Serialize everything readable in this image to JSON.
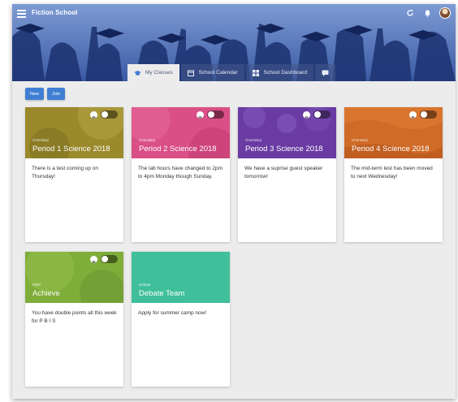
{
  "app": {
    "title": "Fiction School"
  },
  "colors": {
    "accent": "#3f7fd3",
    "banner": "#4a6cb6",
    "page_bg": "#ececec"
  },
  "top_icons": [
    "refresh-icon",
    "bell-icon",
    "avatar"
  ],
  "tabs": [
    {
      "label": "My Classes",
      "icon": "graduation-cap-icon",
      "active": true
    },
    {
      "label": "School Calendar",
      "icon": "calendar-icon",
      "active": false
    },
    {
      "label": "School Dashboard",
      "icon": "dashboard-icon",
      "active": false
    },
    {
      "label": "",
      "icon": "message-icon",
      "active": false
    }
  ],
  "actions": {
    "new_label": "New",
    "join_label": "Join"
  },
  "cards": [
    {
      "subject": "Chemistry",
      "title": "Period 1 Science 2018",
      "body": "There is a test coming up on Thursday!",
      "color": "#9b8a2c"
    },
    {
      "subject": "Chemistry",
      "title": "Period 2 Science 2018",
      "body": "The lab hours have changed to 2pm to 4pm Monday though Sunday.",
      "color": "#d94f86"
    },
    {
      "subject": "Chemistry",
      "title": "Period 3 Science 2018",
      "body": "We have a suprise guest speaker tomorrow!",
      "color": "#6a3ba3"
    },
    {
      "subject": "Chemistry",
      "title": "Period 4 Science 2018",
      "body": "The mid-term test has been moved to next Wednesday!",
      "color": "#cf6a27"
    },
    {
      "subject": "PBIS",
      "title": "Achieve",
      "body": "You have double points all this week for P B I S",
      "color": "#7fad3a"
    },
    {
      "subject": "Debate",
      "title": "Debate Team",
      "body": "Apply for summer camp now!",
      "color": "#3fbf9a"
    }
  ]
}
